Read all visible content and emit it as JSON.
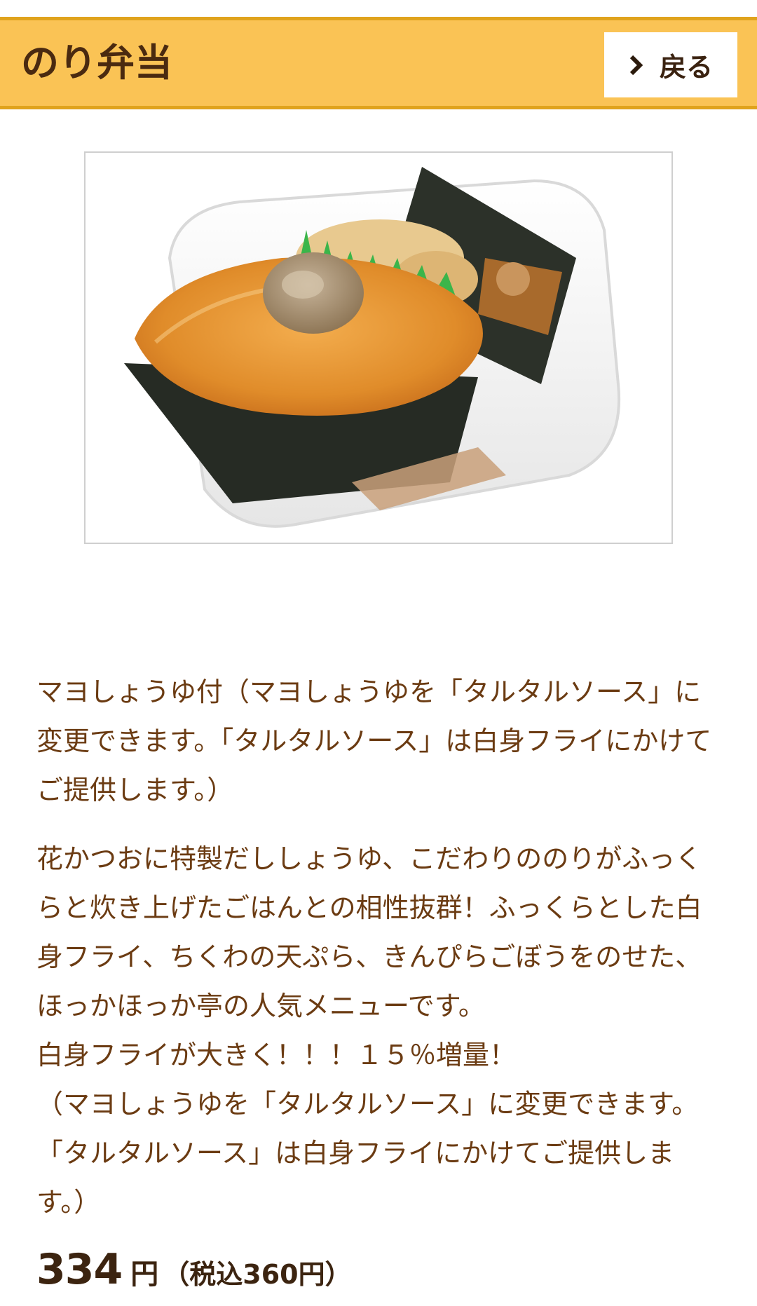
{
  "header": {
    "title": "のり弁当",
    "back_label": "戻る"
  },
  "product": {
    "photo_icon": "bento-photo",
    "topping_note": "マヨしょうゆ付（マヨしょうゆを「タルタルソース」に変更できます。「タルタルソース」は白身フライにかけてご提供します。）",
    "description_lines": [
      "花かつおに特製だししょうゆ、こだわりののりがふっくらと炊き上げたごはんとの相性抜群！ふっくらとした白身フライ、ちくわの天ぷら、きんぴらごぼうをのせた、ほっかほっか亭の人気メニューです。",
      "白身フライが大きく！！！１５％増量！",
      "（マヨしょうゆを「タルタルソース」に変更できます。「タルタルソース」は白身フライにかけてご提供します。）"
    ],
    "price": {
      "value": "334",
      "unit": "円",
      "tax_included": "（税込360円）"
    }
  },
  "colors": {
    "header_bg": "#fac355",
    "header_border": "#e0a31c",
    "title_text": "#4a2a10",
    "body_text": "#6b3b12",
    "price_text": "#3c2410"
  }
}
